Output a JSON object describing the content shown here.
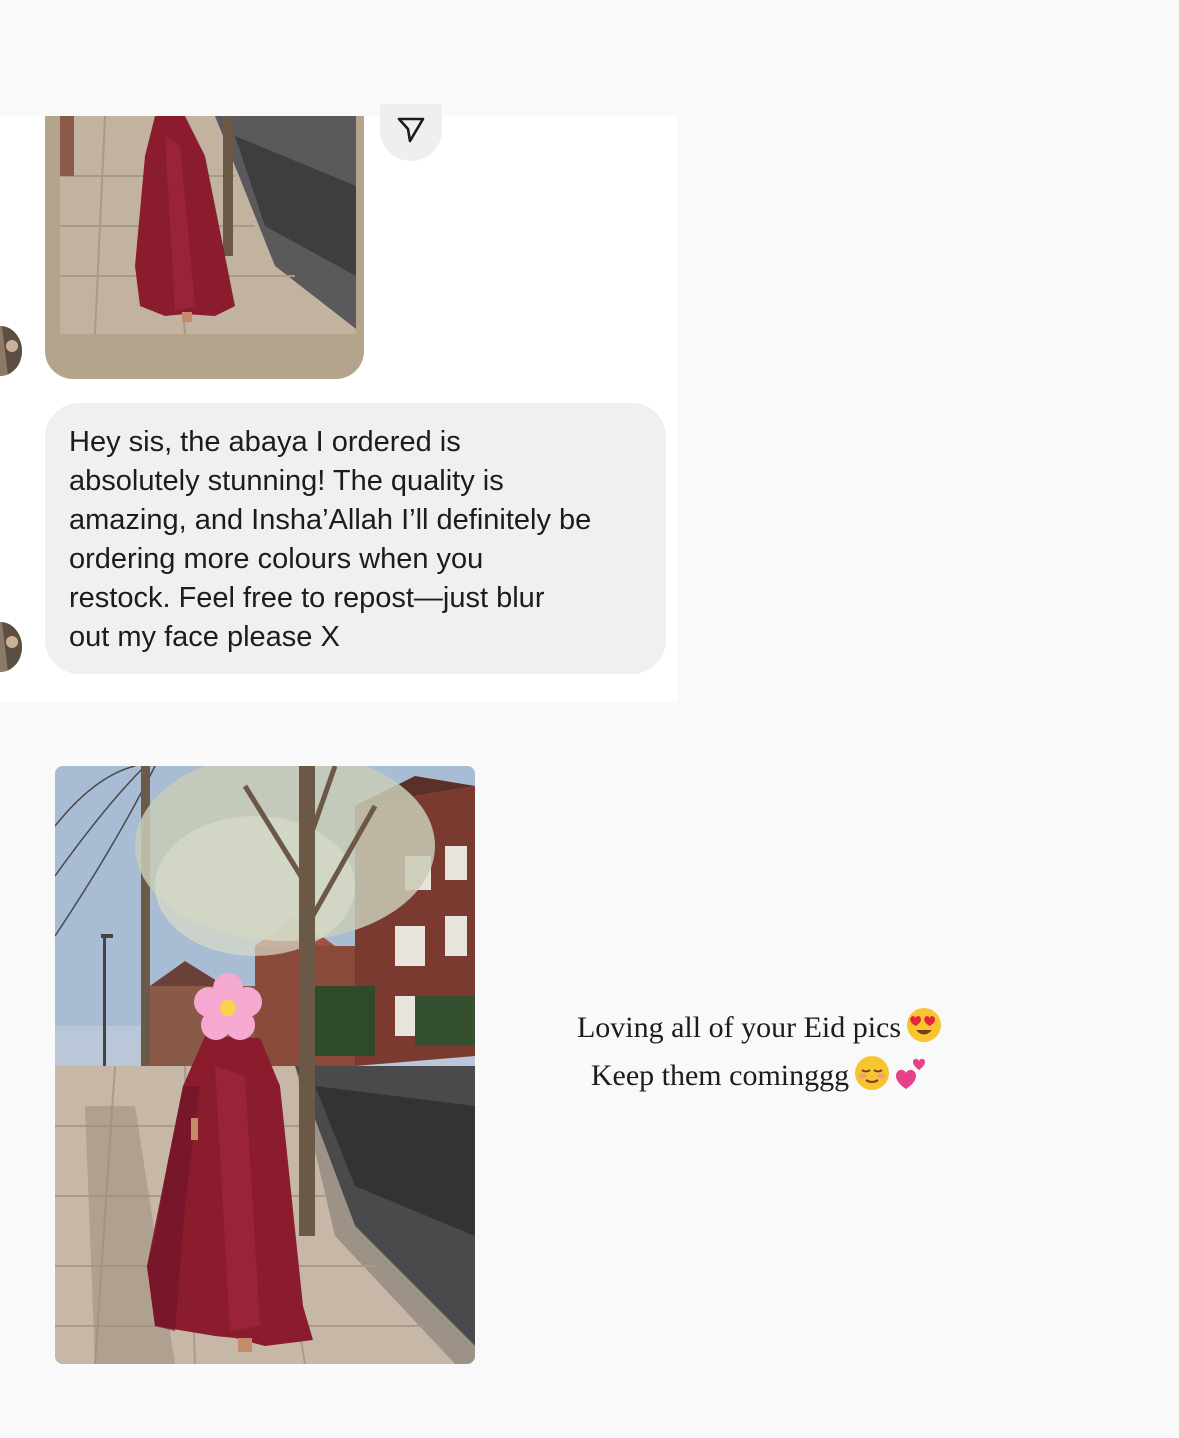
{
  "chat": {
    "message": "Hey sis, the abaya I ordered is\nabsolutely stunning! The quality is\namazing, and Insha’Allah I’ll definitely be\nordering more colours when you\nrestock. Feel free to repost—just blur\nout my face please X"
  },
  "icons": {
    "share": "paper-plane-icon",
    "caption_line_1": "heart-eyes-emoji",
    "caption_line_2": [
      "relieved-face-emoji",
      "two-hearts-emoji"
    ]
  },
  "caption": {
    "line1": "Loving all of your Eid pics",
    "line2": "Keep them cominggg"
  },
  "colors": {
    "bubble": "#eff0f2",
    "abaya": "#8a1c2e",
    "background": "#f9f9fa"
  }
}
